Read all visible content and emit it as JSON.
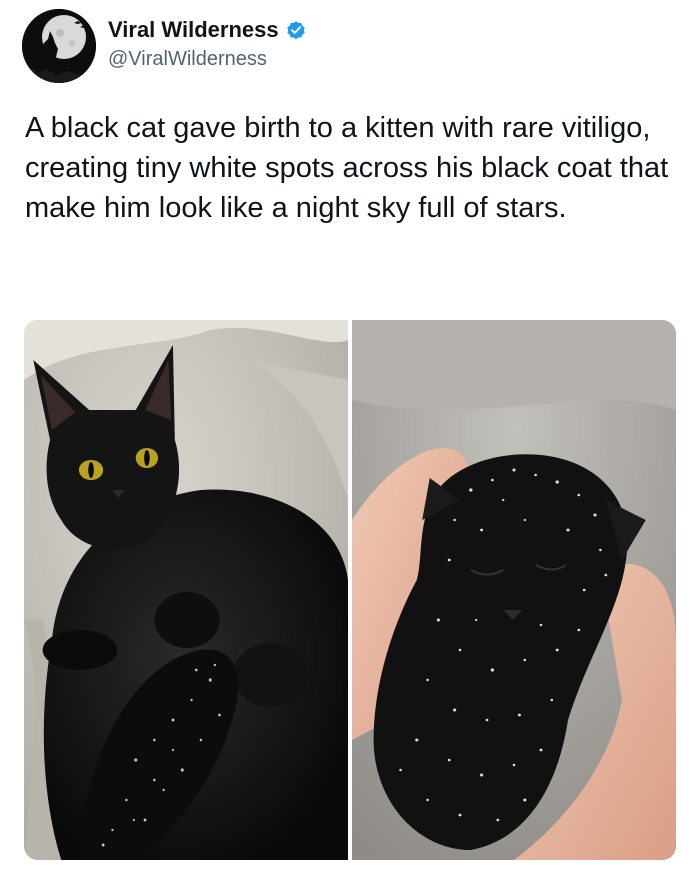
{
  "author": {
    "display_name": "Viral Wilderness",
    "handle": "@ViralWilderness",
    "verified": true,
    "avatar_icon": "wolf-howling-moon-icon",
    "verified_icon": "verified-badge-icon",
    "verified_color": "#1d9bf0"
  },
  "tweet": {
    "text": "A black cat gave birth to a kitten with rare vitiligo, creating tiny white spots across his black coat that make him look like a night sky full of stars."
  },
  "media": {
    "photos": [
      {
        "subject": "black-cat-nursing-kittens"
      },
      {
        "subject": "speckled-kitten-in-hand"
      }
    ]
  }
}
